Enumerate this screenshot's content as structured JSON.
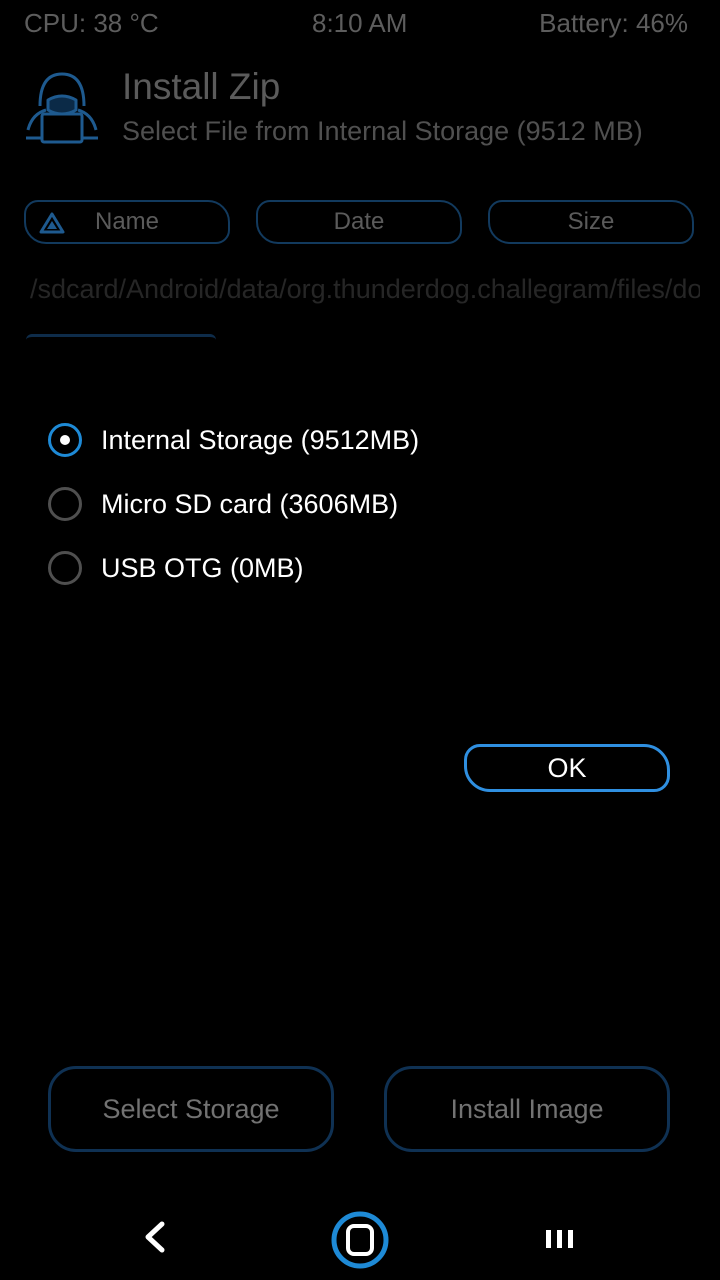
{
  "status_bar": {
    "cpu": "CPU: 38 °C",
    "time": "8:10 AM",
    "battery": "Battery: 46%"
  },
  "header": {
    "title": "Install Zip",
    "subtitle": "Select File from Internal Storage (9512 MB)",
    "icon": "hacker-logo-icon"
  },
  "sort_buttons": {
    "name": "Name",
    "date": "Date",
    "size": "Size",
    "name_icon": "sort-triangle-icon"
  },
  "file_browser": {
    "path": "/sdcard/Android/data/org.thunderdog.challegram/files/do"
  },
  "storage_dialog": {
    "options": [
      {
        "label": "Internal Storage (9512MB)",
        "selected": true
      },
      {
        "label": "Micro SD card (3606MB)",
        "selected": false
      },
      {
        "label": "USB OTG (0MB)",
        "selected": false
      }
    ],
    "ok_label": "OK"
  },
  "actions": {
    "select_storage": "Select Storage",
    "install_image": "Install Image"
  },
  "nav_bar": {
    "back_icon": "back-icon",
    "home_icon": "home-icon",
    "menu_icon": "menu-icon"
  },
  "colors": {
    "accent": "#1e8ad6",
    "button_border": "#0f3153",
    "background": "#000000"
  }
}
